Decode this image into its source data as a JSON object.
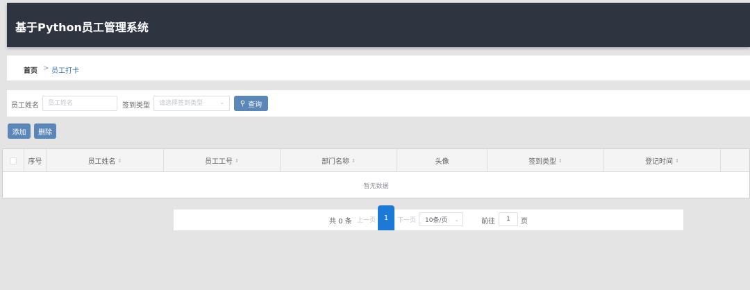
{
  "app": {
    "title": "基于Python员工管理系统"
  },
  "breadcrumb": {
    "home": "首页",
    "separator": ">",
    "current": "员工打卡"
  },
  "search": {
    "name_label": "员工姓名",
    "name_placeholder": "员工姓名",
    "type_label": "签到类型",
    "type_placeholder": "请选择签到类型",
    "query_button": "查询"
  },
  "actions": {
    "add": "添加",
    "delete": "删除"
  },
  "table": {
    "columns": [
      "序号",
      "员工姓名",
      "员工工号",
      "部门名称",
      "头像",
      "签到类型",
      "登记时间"
    ],
    "sortable": [
      false,
      true,
      true,
      true,
      false,
      true,
      true
    ],
    "empty_text": "暂无数据"
  },
  "pagination": {
    "total_text": "共 0 条",
    "prev": "上一页",
    "current_page": "1",
    "next": "下一页",
    "page_size": "10条/页",
    "goto_label": "前往",
    "goto_value": "1",
    "page_word": "页"
  },
  "colors": {
    "header_bg": "#2e3440",
    "primary_button": "#5b86b8",
    "active_page": "#1c7ad6"
  }
}
